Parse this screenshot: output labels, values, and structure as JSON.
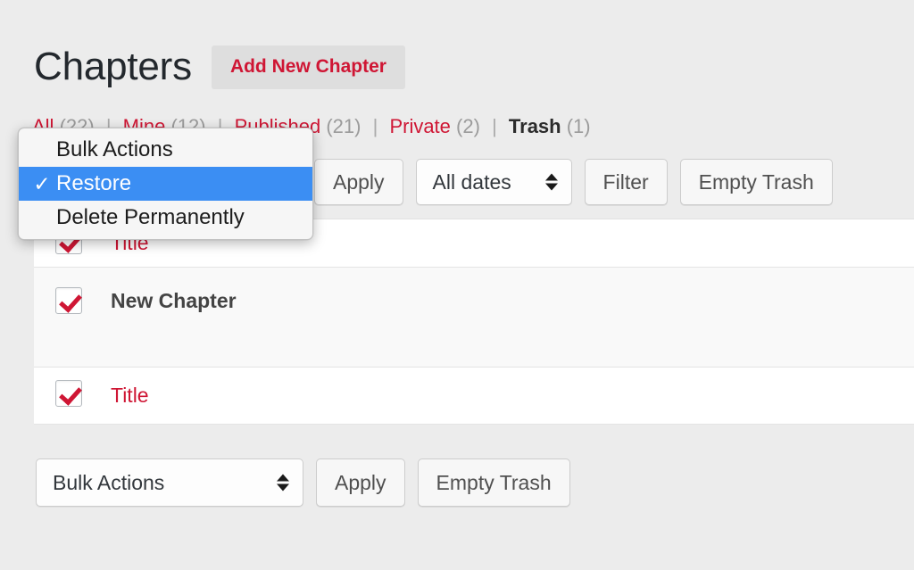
{
  "header": {
    "title": "Chapters",
    "add_new_label": "Add New Chapter"
  },
  "filter_links": [
    {
      "label": "All",
      "count": "(22)",
      "current": false
    },
    {
      "label": "Mine",
      "count": "(12)",
      "current": false
    },
    {
      "label": "Published",
      "count": "(21)",
      "current": false
    },
    {
      "label": "Private",
      "count": "(2)",
      "current": false
    },
    {
      "label": "Trash",
      "count": "(1)",
      "current": true
    }
  ],
  "separator": "|",
  "tablenav_top": {
    "bulk_select_value": "Bulk Actions",
    "apply_label": "Apply",
    "dates_select_value": "All dates",
    "filter_label": "Filter",
    "empty_trash_label": "Empty Trash"
  },
  "open_dropdown": {
    "name": "bulk-actions-menu",
    "checkmark": "✓",
    "highlight_color": "#3b8ef3",
    "items": [
      {
        "label": "Bulk Actions",
        "selected": false
      },
      {
        "label": "Restore",
        "selected": true
      },
      {
        "label": "Delete Permanently",
        "selected": false
      }
    ]
  },
  "table": {
    "header_row": {
      "title": "Title",
      "checked": true
    },
    "rows": [
      {
        "title": "New Chapter",
        "checked": true,
        "style": "dark"
      },
      {
        "title": "Title",
        "checked": true,
        "style": "red"
      }
    ]
  },
  "tablenav_bottom": {
    "bulk_select_value": "Bulk Actions",
    "apply_label": "Apply",
    "empty_trash_label": "Empty Trash"
  },
  "colors": {
    "page_background": "#ececec",
    "accent_red": "#cf1634",
    "selection_blue": "#3b8ef3",
    "row_alt": "#f9f9f9"
  }
}
